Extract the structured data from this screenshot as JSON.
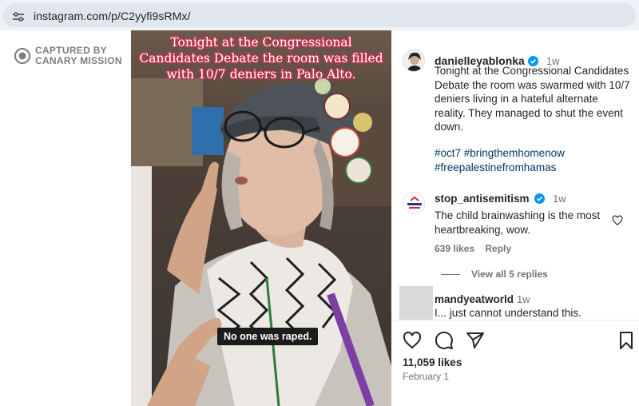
{
  "browser": {
    "url": "instagram.com/p/C2yyfi9sRMx/",
    "site_info_icon": "tune-icon"
  },
  "watermark": {
    "line1": "CAPTURED BY",
    "line2": "CANARY MISSION",
    "icon": "canary-logo"
  },
  "media": {
    "overlay_caption": "Tonight at the Congressional Candidates Debate the room was filled with 10/7 deniers in Palo Alto.",
    "subtitle": "No one was raped."
  },
  "post": {
    "username": "danielleyablonka",
    "verified": true,
    "time": "1w",
    "caption": "Tonight at the Congressional Candidates Debate the room was swarmed with 10/7 deniers living in a hateful alternate reality. They managed to shut the event down.",
    "hashtags_line1": "#oct7 #bringthemhomenow",
    "hashtags_line2": "#freepalestinefromhamas"
  },
  "comments": [
    {
      "username": "stop_antisemitism",
      "verified": true,
      "time": "1w",
      "text": "The child brainwashing is the most heartbreaking, wow.",
      "likes": "639 likes",
      "reply_label": "Reply",
      "view_replies": "View all 5 replies"
    },
    {
      "username": "mandyeatworld",
      "time": "1w",
      "text": "I... just cannot understand this."
    }
  ],
  "footer": {
    "likes": "11,059 likes",
    "date": "February 1"
  },
  "colors": {
    "verified_blue": "#0095f6",
    "link_blue": "#00376b",
    "caption_glow": "#ff2a5a"
  }
}
